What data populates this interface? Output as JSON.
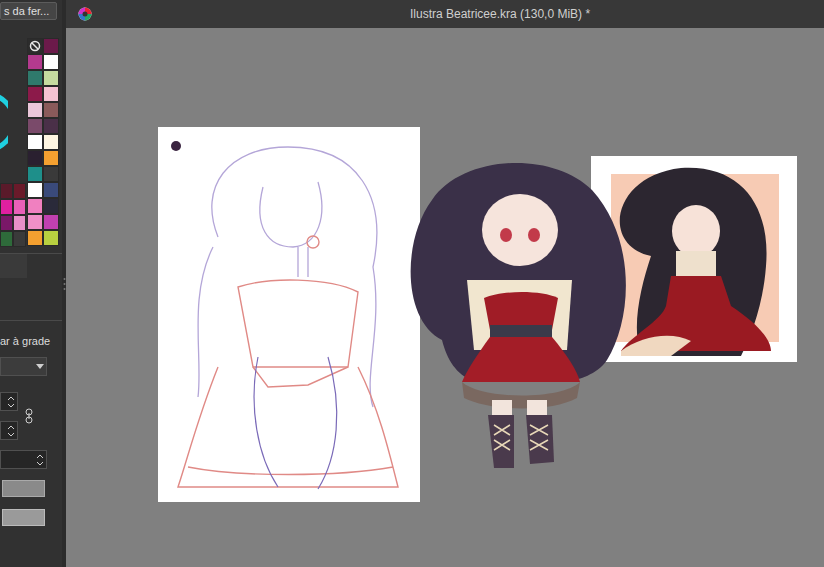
{
  "window": {
    "title": "Ilustra Beatricee.kra (130,0 MiB) *"
  },
  "docker_tab": {
    "label": "s da fer..."
  },
  "palette": {
    "swatches": [
      {
        "color": "#2c2c2c",
        "kind": "none"
      },
      {
        "color": "#6b1a4a",
        "kind": "color"
      },
      {
        "color": "#b43a8e",
        "kind": "color"
      },
      {
        "color": "#ffffff",
        "kind": "color"
      },
      {
        "color": "#2f7a6c",
        "kind": "color"
      },
      {
        "color": "#c6dba0",
        "kind": "color"
      },
      {
        "color": "#8c1a4a",
        "kind": "color"
      },
      {
        "color": "#f4c2d2",
        "kind": "color"
      },
      {
        "color": "#ebc7da",
        "kind": "color"
      },
      {
        "color": "#8a5a5a",
        "kind": "color"
      },
      {
        "color": "#7a4a6a",
        "kind": "color"
      },
      {
        "color": "#4a3048",
        "kind": "color"
      },
      {
        "color": "#ffffff",
        "kind": "color"
      },
      {
        "color": "#fff6e2",
        "kind": "color"
      },
      {
        "color": "#2a2030",
        "kind": "color"
      },
      {
        "color": "#f4a030",
        "kind": "color"
      },
      {
        "color": "#1e8f8a",
        "kind": "color"
      },
      {
        "color": "#3a3a3a",
        "kind": "color"
      },
      {
        "color": "#ffffff",
        "kind": "color"
      },
      {
        "color": "#3a4a7a",
        "kind": "color"
      },
      {
        "color": "#f080c0",
        "kind": "color"
      },
      {
        "color": "#2a2a3a",
        "kind": "color"
      },
      {
        "color": "#f090c8",
        "kind": "color"
      },
      {
        "color": "#c040b0",
        "kind": "color"
      },
      {
        "color": "#f4a030",
        "kind": "color"
      },
      {
        "color": "#b8d040",
        "kind": "color"
      }
    ]
  },
  "small_palette": {
    "swatches": [
      {
        "color": "#5a1a2a"
      },
      {
        "color": "#6a1a2a"
      },
      {
        "color": "#e020a0"
      },
      {
        "color": "#e860b8"
      },
      {
        "color": "#7a1868"
      },
      {
        "color": "#e890c8"
      },
      {
        "color": "#2e6a3a"
      },
      {
        "color": "#3a3a3a"
      }
    ]
  },
  "tool_options": {
    "label": "ar à grade"
  }
}
